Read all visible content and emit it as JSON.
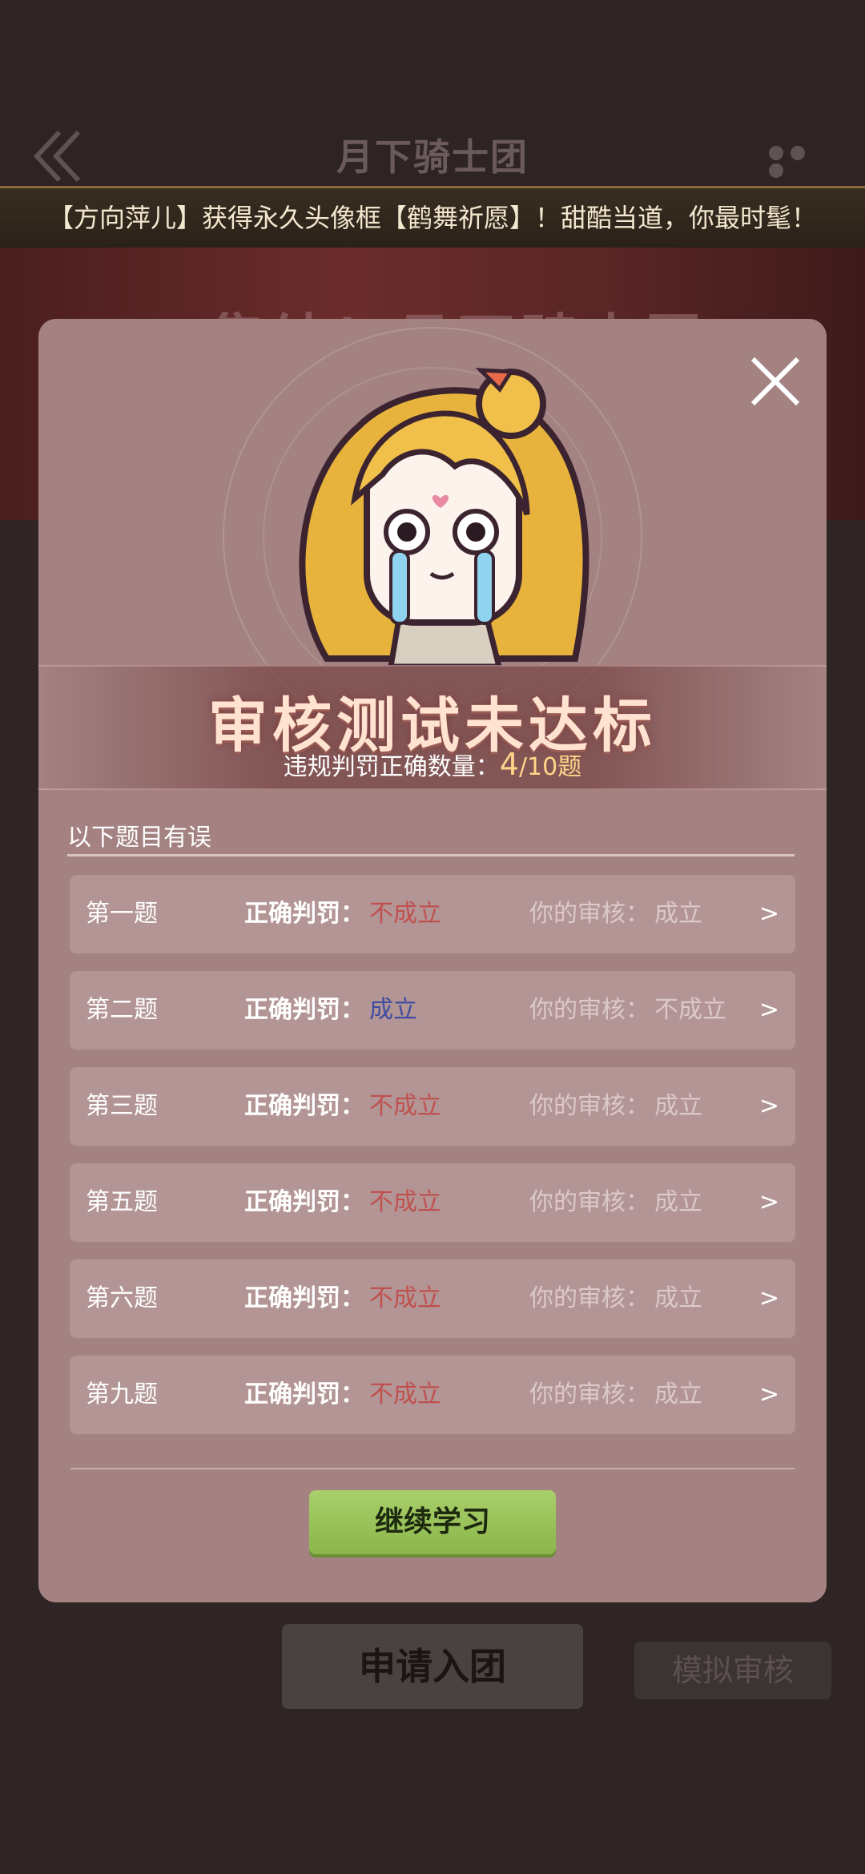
{
  "header": {
    "title": "月下骑士团"
  },
  "marquee": {
    "text": "【方向萍儿】获得永久头像框【鹤舞祈愿】！甜酷当道，你最时髦！"
  },
  "banner": {
    "title": "集结！月下骑士团"
  },
  "actions": {
    "apply_label": "申请入团",
    "mock_review_label": "模拟审核"
  },
  "modal": {
    "result_title": "审核测试未达标",
    "score_prefix": "违规判罚正确数量：",
    "score_value": "4",
    "score_total": "/10题",
    "wrong_heading": "以下题目有误",
    "correct_label": "正确判罚：",
    "your_label": "你的审核：",
    "continue_label": "继续学习",
    "rows": [
      {
        "question": "第一题",
        "correct": "不成立",
        "yours": "成立"
      },
      {
        "question": "第二题",
        "correct": "成立",
        "yours": "不成立"
      },
      {
        "question": "第三题",
        "correct": "不成立",
        "yours": "成立"
      },
      {
        "question": "第五题",
        "correct": "不成立",
        "yours": "成立"
      },
      {
        "question": "第六题",
        "correct": "不成立",
        "yours": "成立"
      },
      {
        "question": "第九题",
        "correct": "不成立",
        "yours": "成立"
      }
    ],
    "arrow": ">"
  },
  "colors": {
    "modal_bg": "#a48282",
    "row_bg": "#b39595",
    "not_established": "#c0504f",
    "established": "#3f4ca0",
    "continue_button": "#9ec45c",
    "score_highlight": "#ffd58a"
  },
  "icons": {
    "back": "double-chevron-left-icon",
    "more": "more-dots-icon",
    "close": "close-icon"
  }
}
